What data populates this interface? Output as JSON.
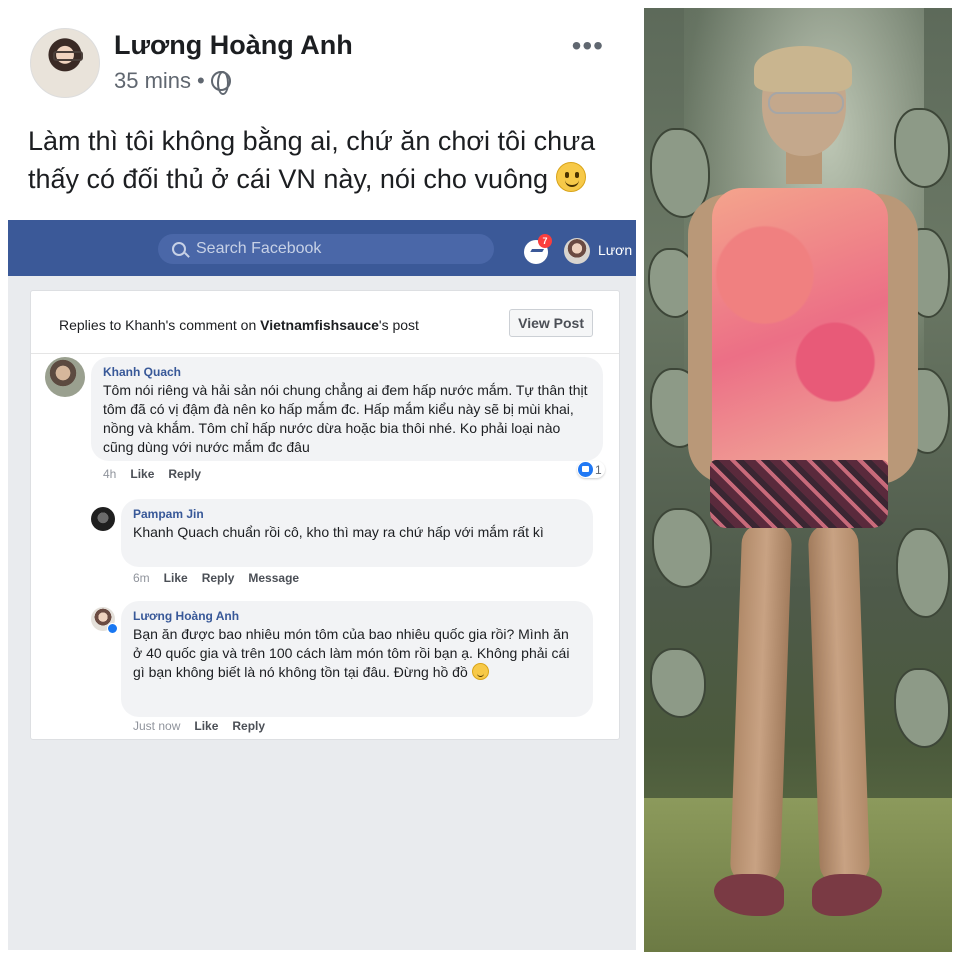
{
  "post": {
    "author": "Lương Hoàng Anh",
    "time": "35 mins",
    "separator": "•",
    "more_glyph": "•••",
    "text": "Làm thì tôi không bằng ai, chứ ăn chơi tôi chưa thấy có đối thủ ở cái VN này, nói cho vuông"
  },
  "fb_header": {
    "search_placeholder": "Search Facebook",
    "messenger_badge": "7",
    "user_short": "Lươn"
  },
  "replies_card": {
    "prefix": "Replies to Khanh's comment on ",
    "page": "Vietnamfishsauce",
    "suffix": "'s post",
    "view_post_label": "View Post"
  },
  "comments": [
    {
      "name": "Khanh Quach",
      "text": "Tôm nói riêng và hải sản nói chung chẳng ai đem hấp nước mắm. Tự thân thịt tôm đã có vị đậm đà nên ko hấp mắm đc. Hấp mắm kiểu này sẽ bị mùi khai, nồng và khắm. Tôm chỉ hấp nước dừa hoặc bia thôi nhé. Ko phải loại nào cũng dùng với nước mắm đc đâu",
      "time": "4h",
      "like": "Like",
      "reply": "Reply",
      "reactions": "1"
    },
    {
      "name": "Pampam Jin",
      "text": "Khanh Quach  chuẩn rồi cô, kho thì may ra chứ hấp với mắm rất kì",
      "time": "6m",
      "like": "Like",
      "reply": "Reply",
      "message": "Message"
    },
    {
      "name": "Lương Hoàng Anh",
      "text": "Bạn ăn được bao nhiêu món tôm của bao nhiêu quốc gia rồi? Mình ăn ở 40 quốc gia và trên 100 cách làm món tôm rồi bạn ạ. Không phải cái gì bạn không biết là nó không tồn tại đâu. Đừng hồ đồ",
      "time": "Just now",
      "like": "Like",
      "reply": "Reply"
    }
  ],
  "colors": {
    "facebook_blue": "#3b5998",
    "link_blue": "#385898",
    "bubble_gray": "#f2f3f5",
    "page_gray": "#e9ebee"
  },
  "icons": [
    "globe-icon",
    "more-icon",
    "smiley-icon",
    "search-icon",
    "messenger-icon",
    "thumbs-up-icon",
    "verified-icon"
  ]
}
